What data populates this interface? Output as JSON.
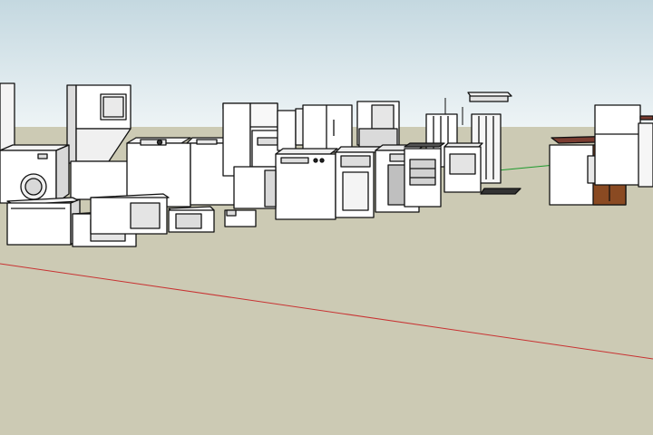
{
  "scene": {
    "sky_top": "#c4d8e0",
    "sky_bottom": "#eef4f6",
    "ground": "#cccab4",
    "outline": "#111111",
    "red_axis": "#c83232",
    "green_axis": "#1e9a2e",
    "wood": "#8a4a22",
    "brick": "#7a3c30"
  }
}
